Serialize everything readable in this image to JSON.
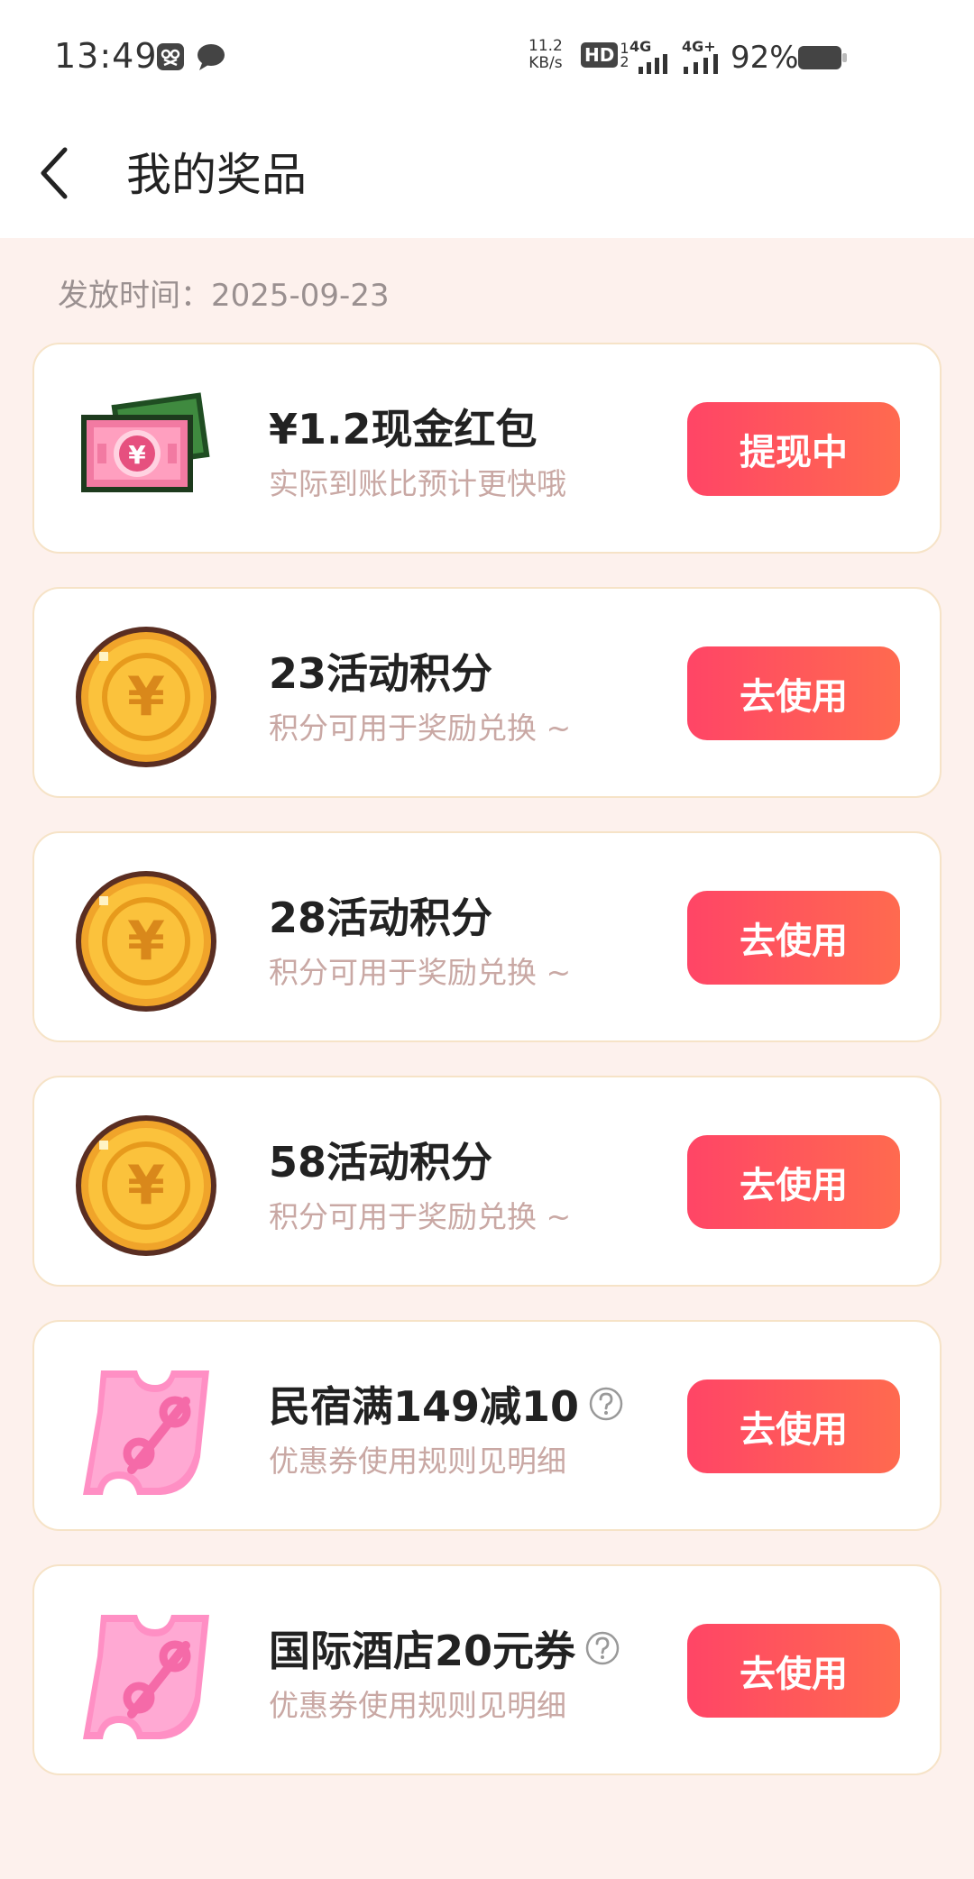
{
  "status_bar": {
    "time": "13:49",
    "net_speed_value": "11.2",
    "net_speed_unit": "KB/s",
    "hd_label": "HD",
    "signal_1_label": "4G",
    "signal_2_label": "4G+",
    "battery_percent": "92%"
  },
  "header": {
    "title": "我的奖品"
  },
  "issue_date": "发放时间：2025-09-23",
  "prizes": [
    {
      "title": "¥1.2现金红包",
      "subtitle": "实际到账比预计更快哦",
      "button": "提现中",
      "icon": "cash-banknote-icon",
      "has_help": false
    },
    {
      "title": "23活动积分",
      "subtitle": "积分可用于奖励兑换 ~",
      "button": "去使用",
      "icon": "gold-coin-icon",
      "has_help": false
    },
    {
      "title": "28活动积分",
      "subtitle": "积分可用于奖励兑换 ~",
      "button": "去使用",
      "icon": "gold-coin-icon",
      "has_help": false
    },
    {
      "title": "58活动积分",
      "subtitle": "积分可用于奖励兑换 ~",
      "button": "去使用",
      "icon": "gold-coin-icon",
      "has_help": false
    },
    {
      "title": "民宿满149减10",
      "subtitle": "优惠券使用规则见明细",
      "button": "去使用",
      "icon": "coupon-ticket-icon",
      "has_help": true
    },
    {
      "title": "国际酒店20元券",
      "subtitle": "优惠券使用规则见明细",
      "button": "去使用",
      "icon": "coupon-ticket-icon",
      "has_help": true
    }
  ],
  "colors": {
    "page_background": "#fdf1ed",
    "card_border": "#f6e3c7",
    "button_gradient_start": "#ff4566",
    "button_gradient_end": "#ff6a4f",
    "subtitle_text": "#c9a8a4"
  }
}
